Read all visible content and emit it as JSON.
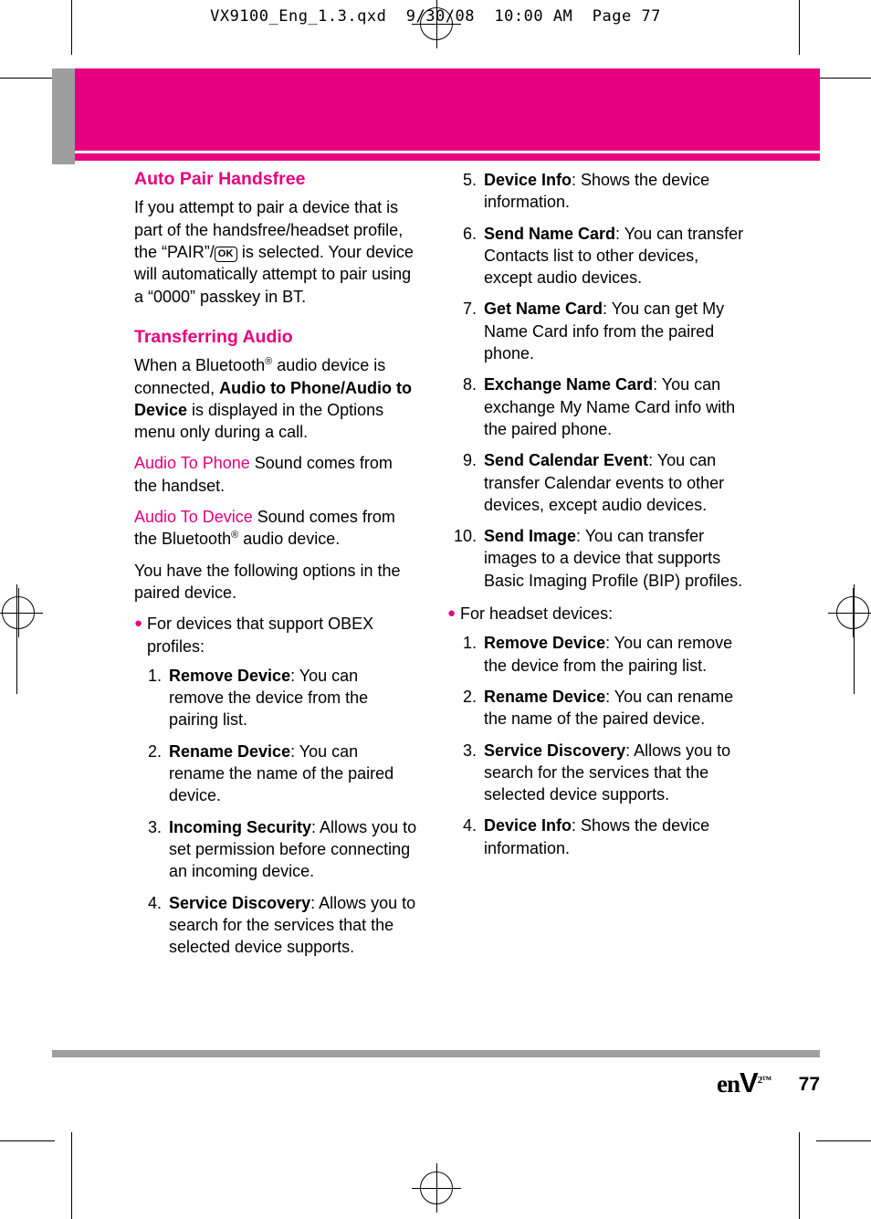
{
  "print_header": "VX9100_Eng_1.3.qxd  9/30/08  10:00 AM  Page 77",
  "colors": {
    "accent": "#e6007e",
    "grey": "#9e9e9e",
    "text": "#000000"
  },
  "left_column": {
    "section1_title": "Auto Pair Handsfree",
    "section1_para_part1": "If you attempt to pair a device that is part of the handsfree/headset profile, the “PAIR”/",
    "section1_ok_key": "OK",
    "section1_para_part2": " is selected. Your device will automatically attempt to pair using a “0000” passkey in BT.",
    "section2_title": "Transferring Audio",
    "section2_para_a_1": "When a Bluetooth",
    "section2_para_a_2": " audio device is connected, ",
    "section2_para_a_bold": "Audio to Phone/Audio to Device",
    "section2_para_a_3": " is displayed in the Options menu only during a call.",
    "audio_to_phone_term": "Audio To Phone",
    "audio_to_phone_desc": " Sound comes from the handset.",
    "audio_to_device_term": "Audio To Device",
    "audio_to_device_desc_1": " Sound comes from the Bluetooth",
    "audio_to_device_desc_2": " audio device.",
    "options_intro": "You have the following options in the paired device.",
    "obex_bullet": "For devices that support OBEX profiles:",
    "obex_list": [
      {
        "num": "1.",
        "bold": "Remove Device",
        "rest": ": You can remove the device from the pairing list."
      },
      {
        "num": "2.",
        "bold": "Rename Device",
        "rest": ": You can rename the name of the paired device."
      },
      {
        "num": "3.",
        "bold": "Incoming Security",
        "rest": ": Allows you to set permission before connecting an incoming device."
      },
      {
        "num": "4.",
        "bold": "Service Discovery",
        "rest": ": Allows you to search for the services that the selected device supports."
      }
    ]
  },
  "right_column": {
    "obex_list_continued": [
      {
        "num": "5.",
        "bold": "Device Info",
        "rest": ": Shows the device information."
      },
      {
        "num": "6.",
        "bold": "Send Name Card",
        "rest": ": You can transfer Contacts list to other devices, except audio devices."
      },
      {
        "num": "7.",
        "bold": "Get Name Card",
        "rest": ": You can get My Name Card info from the paired phone."
      },
      {
        "num": "8.",
        "bold": "Exchange Name Card",
        "rest": ": You can exchange My Name Card info with the paired phone."
      },
      {
        "num": "9.",
        "bold": "Send Calendar Event",
        "rest": ": You can transfer Calendar events to other devices, except audio devices."
      },
      {
        "num": "10.",
        "bold": "Send Image",
        "rest": ": You can transfer images to a device that supports Basic Imaging Profile (BIP) profiles."
      }
    ],
    "headset_bullet": "For headset devices:",
    "headset_list": [
      {
        "num": "1.",
        "bold": "Remove Device",
        "rest": ": You can remove the device from the pairing list."
      },
      {
        "num": "2.",
        "bold": "Rename Device",
        "rest": ": You can rename the name of the paired device."
      },
      {
        "num": "3.",
        "bold": "Service Discovery",
        "rest": ": Allows you to search for the services that the selected device supports."
      },
      {
        "num": "4.",
        "bold": "Device Info",
        "rest": ": Shows the device information."
      }
    ]
  },
  "footer": {
    "logo_text": "en",
    "logo_v": "V",
    "logo_sup2": "2",
    "logo_tm": "™",
    "page_number": "77"
  }
}
